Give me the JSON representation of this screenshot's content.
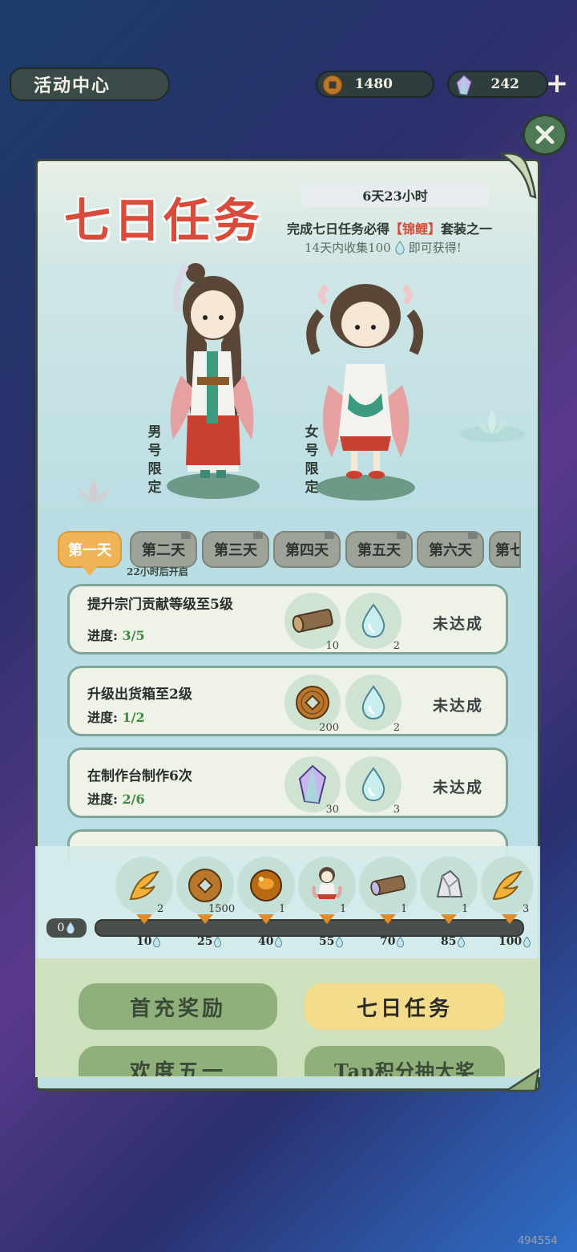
{
  "header": {
    "title": "活动中心",
    "coins": "1480",
    "gems": "242",
    "plus": "+"
  },
  "event": {
    "title": "七日任务",
    "timer": "6天23小时",
    "desc_prefix": "完成七日任务必得",
    "desc_highlight": "【锦鲤】",
    "desc_suffix": "套装之一",
    "collect_prefix": "14天内收集100",
    "collect_suffix": "即可获得!",
    "male_label": "男号限定",
    "female_label": "女号限定"
  },
  "tabs": [
    {
      "label": "第一天",
      "active": true
    },
    {
      "label": "第二天",
      "active": false
    },
    {
      "label": "第三天",
      "active": false
    },
    {
      "label": "第四天",
      "active": false
    },
    {
      "label": "第五天",
      "active": false
    },
    {
      "label": "第六天",
      "active": false
    },
    {
      "label": "第七",
      "active": false
    }
  ],
  "tab_note": "22小时后开启",
  "tasks": [
    {
      "name": "提升宗门贡献等级至5级",
      "progress_label": "进度:",
      "progress": "3/5",
      "reward1_icon": "wood-log-icon",
      "reward1_count": "10",
      "reward2_icon": "water-drop-icon",
      "reward2_count": "2",
      "status": "未达成"
    },
    {
      "name": "升级出货箱至2级",
      "progress_label": "进度:",
      "progress": "1/2",
      "reward1_icon": "copper-coin-icon",
      "reward1_count": "200",
      "reward2_icon": "water-drop-icon",
      "reward2_count": "2",
      "status": "未达成"
    },
    {
      "name": "在制作台制作6次",
      "progress_label": "进度:",
      "progress": "2/6",
      "reward1_icon": "crystal-gem-icon",
      "reward1_count": "30",
      "reward2_icon": "water-drop-icon",
      "reward2_count": "3",
      "status": "未达成"
    }
  ],
  "milestones": {
    "current": "0",
    "items": [
      {
        "icon": "golden-feather-icon",
        "count": "2",
        "threshold": "10"
      },
      {
        "icon": "copper-coin-icon",
        "count": "1500",
        "threshold": "25"
      },
      {
        "icon": "amber-orb-icon",
        "count": "1",
        "threshold": "40"
      },
      {
        "icon": "character-outfit-icon",
        "count": "1",
        "threshold": "55"
      },
      {
        "icon": "wood-log-icon",
        "count": "1",
        "threshold": "70"
      },
      {
        "icon": "silver-ore-icon",
        "count": "1",
        "threshold": "85"
      },
      {
        "icon": "golden-feather-icon",
        "count": "3",
        "threshold": "100"
      }
    ]
  },
  "bottom_nav": [
    {
      "label": "首充奖励",
      "active": false
    },
    {
      "label": "七日任务",
      "active": true
    },
    {
      "label": "欢度五一",
      "active": false
    },
    {
      "label": "Tap积分抽大奖",
      "active": false
    }
  ],
  "watermark": "494554",
  "colors": {
    "accent_red": "#d94b3a",
    "tab_active": "#f0b456",
    "nav_active": "#f3dc8b",
    "nav_inactive": "#8fb07b",
    "progress_green": "#3d8b3e"
  }
}
